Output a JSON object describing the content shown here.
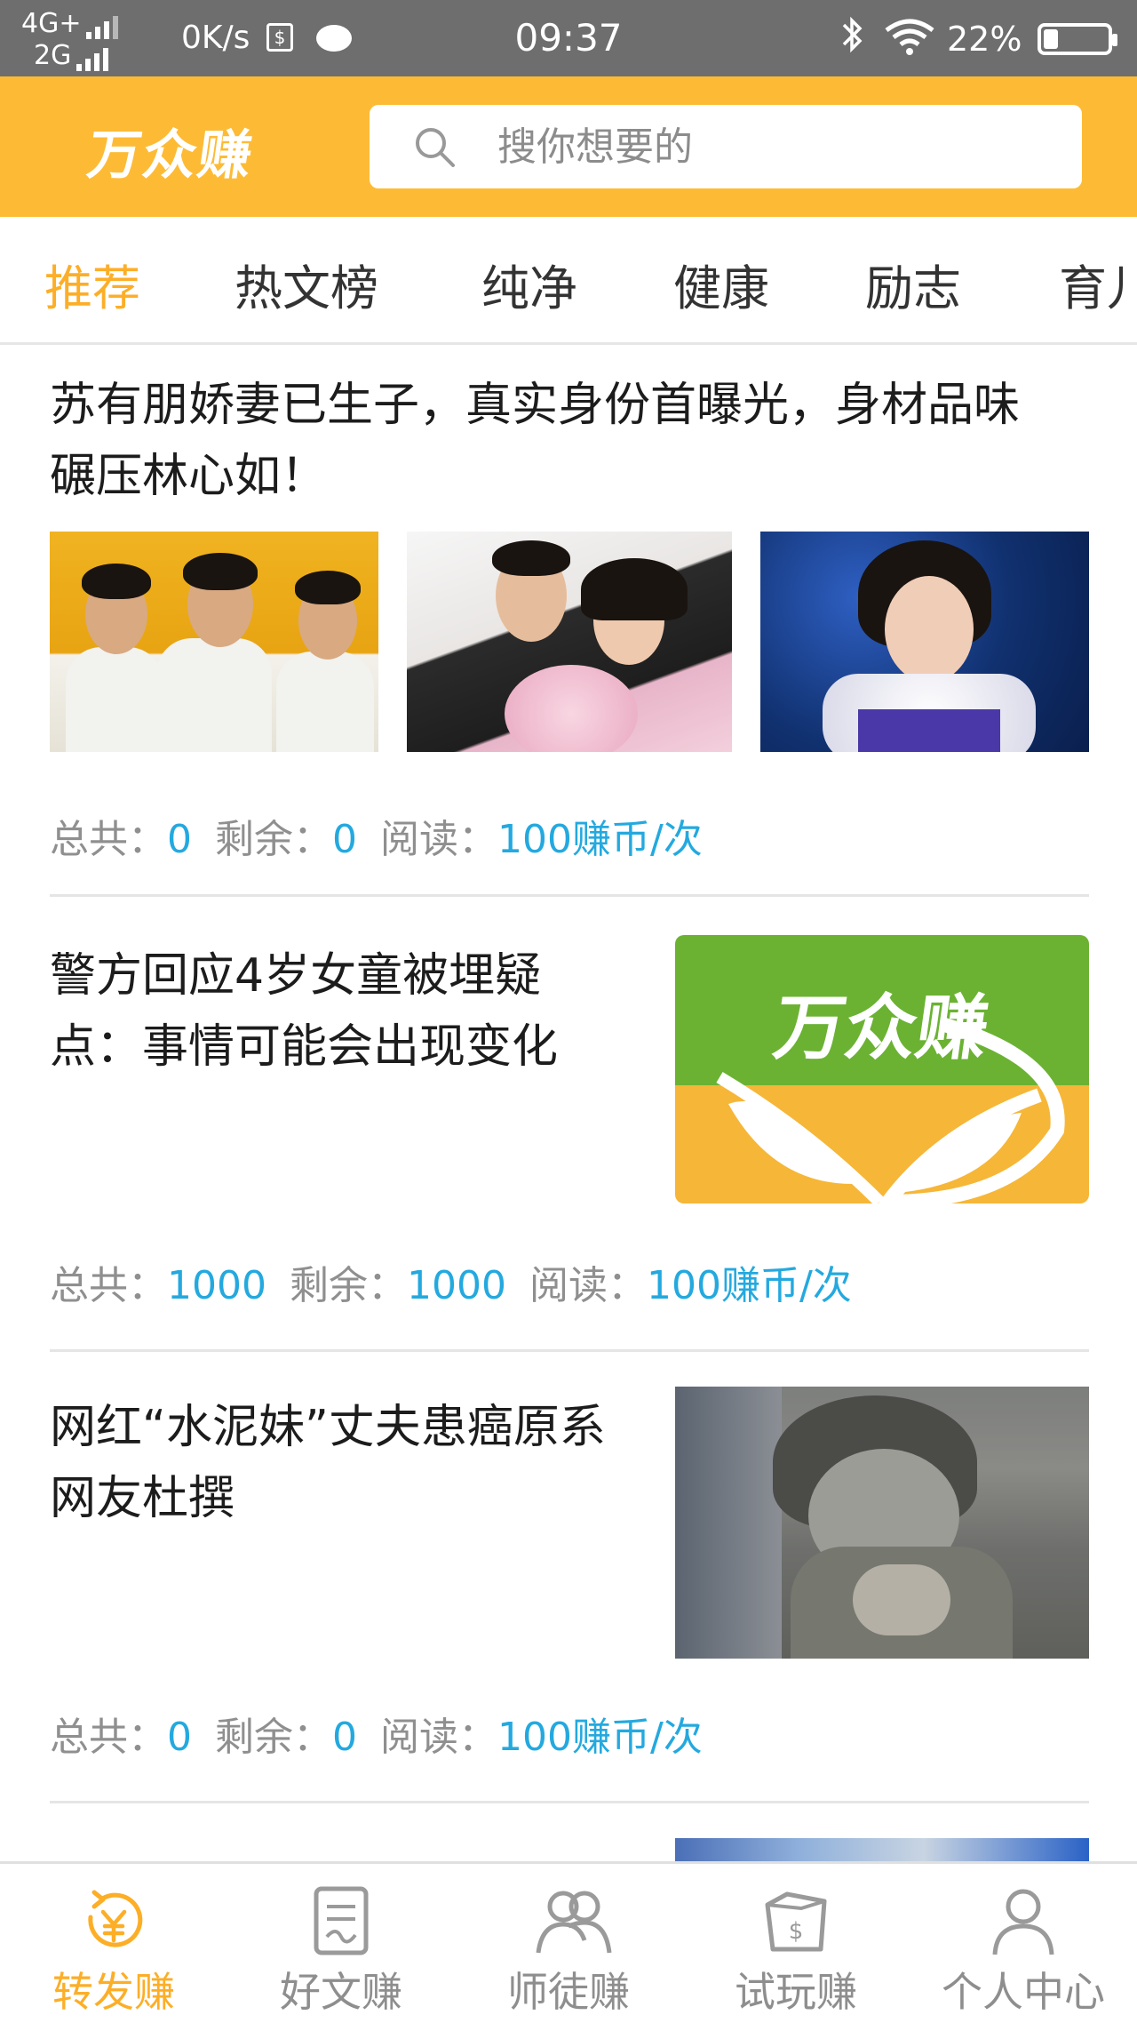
{
  "status_bar": {
    "network_top": "4G+",
    "network_bottom": "2G",
    "speed": "0K/s",
    "time": "09:37",
    "battery": "22%"
  },
  "header": {
    "logo": "万众赚",
    "search_placeholder": "搜你想要的",
    "brand_color": "#fdbb35"
  },
  "tabs": [
    {
      "label": "推荐",
      "active": true
    },
    {
      "label": "热文榜",
      "active": false
    },
    {
      "label": "纯净",
      "active": false
    },
    {
      "label": "健康",
      "active": false
    },
    {
      "label": "励志",
      "active": false
    },
    {
      "label": "育儿",
      "active": false
    }
  ],
  "meta_labels": {
    "total": "总共：",
    "remaining": "剩余：",
    "read": "阅读："
  },
  "articles": [
    {
      "title": "苏有朋娇妻已生子，真实身份首曝光，身材品味碾压林心如！",
      "total": "0",
      "remaining": "0",
      "reward": "100赚币/次"
    },
    {
      "title": "警方回应4岁女童被埋疑点：事情可能会出现变化",
      "thumb_text": "万众赚",
      "total": "1000",
      "remaining": "1000",
      "reward": "100赚币/次"
    },
    {
      "title": "网红“水泥妹”丈夫患癌原系网友杜撰",
      "total": "0",
      "remaining": "0",
      "reward": "100赚币/次"
    }
  ],
  "bottom_nav": [
    {
      "label": "转发赚",
      "icon": "yuan-refresh-icon",
      "active": true
    },
    {
      "label": "好文赚",
      "icon": "article-icon",
      "active": false
    },
    {
      "label": "师徒赚",
      "icon": "two-people-icon",
      "active": false
    },
    {
      "label": "试玩赚",
      "icon": "money-bag-icon",
      "active": false
    },
    {
      "label": "个人中心",
      "icon": "person-icon",
      "active": false
    }
  ],
  "colors": {
    "accent": "#fcae27",
    "value_blue": "#24a9df",
    "muted": "#8f8f8f"
  }
}
